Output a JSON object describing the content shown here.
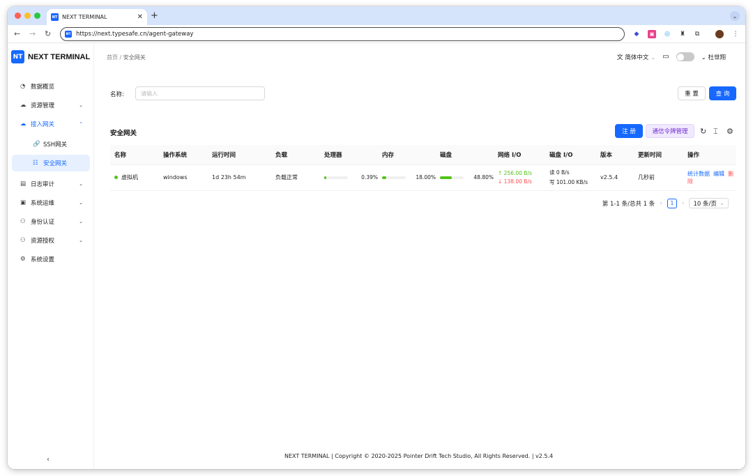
{
  "browser": {
    "tab_title": "NEXT TERMINAL",
    "tab_favicon": "NT",
    "url": "https://next.typesafe.cn/agent-gateway"
  },
  "sidebar": {
    "logo_badge": "NT",
    "logo_text": "NEXT TERMINAL",
    "items": [
      {
        "label": "数据概览",
        "icon": "dashboard-icon"
      },
      {
        "label": "资源管理",
        "icon": "cloud-icon"
      },
      {
        "label": "接入网关",
        "icon": "gateway-icon"
      },
      {
        "label": "SSH网关",
        "icon": "link-icon"
      },
      {
        "label": "安全网关",
        "icon": "cluster-icon"
      },
      {
        "label": "日志审计",
        "icon": "audit-icon"
      },
      {
        "label": "系统运维",
        "icon": "ops-icon"
      },
      {
        "label": "身份认证",
        "icon": "user-icon"
      },
      {
        "label": "资源授权",
        "icon": "user-auth-icon"
      },
      {
        "label": "系统设置",
        "icon": "gear-icon"
      }
    ]
  },
  "header": {
    "breadcrumb": [
      "首页",
      "安全网关"
    ],
    "language": "简体中文",
    "user": "杜世翔"
  },
  "filter": {
    "name_label": "名称:",
    "name_placeholder": "请输入",
    "reset_label": "重 置",
    "query_label": "查 询"
  },
  "card": {
    "title": "安全网关",
    "register_label": "注 册",
    "token_label": "通信令牌管理"
  },
  "table": {
    "columns": [
      "名称",
      "操作系统",
      "运行时间",
      "负载",
      "处理器",
      "内存",
      "磁盘",
      "网络 I/O",
      "磁盘 I/O",
      "版本",
      "更新时间",
      "操作"
    ],
    "rows": [
      {
        "name": "虚拟机",
        "os": "windows",
        "uptime": "1d 23h 54m",
        "load": "负载正常",
        "cpu": "0.39%",
        "cpu_pct": 0.39,
        "mem": "18.00%",
        "mem_pct": 18.0,
        "disk": "48.80%",
        "disk_pct": 48.8,
        "net_up": "↑ 256.00 B/s",
        "net_down": "↓ 138.00 B/s",
        "disk_read": "读 0 B/s",
        "disk_write": "写 101.00 KB/s",
        "version": "v2.5.4",
        "updated": "几秒前",
        "actions": [
          "统计数据",
          "编辑",
          "删除"
        ]
      }
    ]
  },
  "pagination": {
    "summary": "第 1-1 条/总共 1 条",
    "current_page": "1",
    "page_size": "10 条/页"
  },
  "footer": {
    "text": "NEXT TERMINAL | Copyright © 2020-2025 Pointer Drift Tech Studio, All Rights Reserved. | v2.5.4"
  },
  "colors": {
    "primary": "#1668ff",
    "success": "#52c41a",
    "danger": "#ff4d4f",
    "tabbar": "#d5e3fb"
  }
}
